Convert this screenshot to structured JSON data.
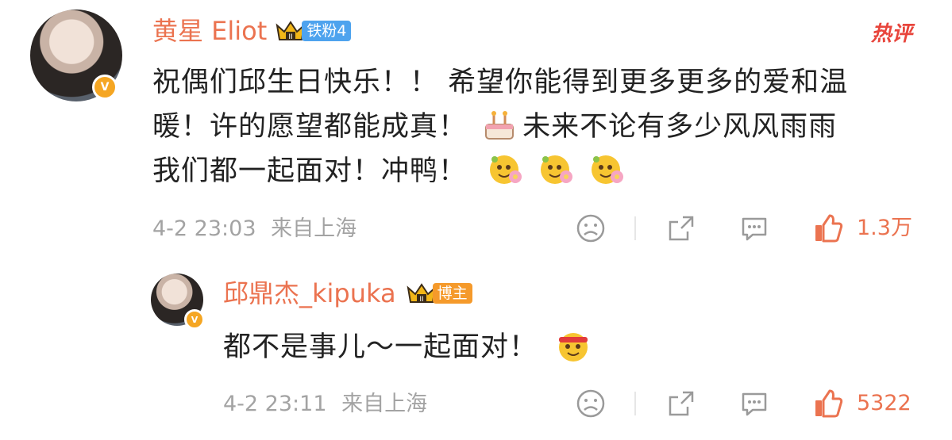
{
  "comment": {
    "username": "黄星 Eliot",
    "fan_badge": "铁粉4",
    "hot_label": "热评",
    "text_lines": [
      "祝偶们邱生日快乐！！ 希望你能得到更多更多的爱和温",
      "暖！许的愿望都能成真！",
      "未来不论有多少风风雨雨",
      "我们都一起面对！冲鸭！"
    ],
    "date": "4-2 23:03",
    "location": "来自上海",
    "like_count": "1.3万"
  },
  "reply": {
    "username": "邱鼎杰_kipuka",
    "role_badge": "博主",
    "text": "都不是事儿～一起面对！",
    "date": "4-2 23:11",
    "location": "来自上海",
    "like_count": "5322"
  },
  "colors": {
    "accent": "#eb7350",
    "meta": "#a3a3a3",
    "fan_badge": "#4ea3ee",
    "role_badge": "#f59a2b",
    "hot": "#e8453c"
  },
  "icons": [
    "sad-face-icon",
    "share-icon",
    "comment-icon",
    "thumbs-up-icon",
    "cake-emoji",
    "flower-face-emoji",
    "headband-face-emoji",
    "crown-icon",
    "verified-badge-icon"
  ]
}
